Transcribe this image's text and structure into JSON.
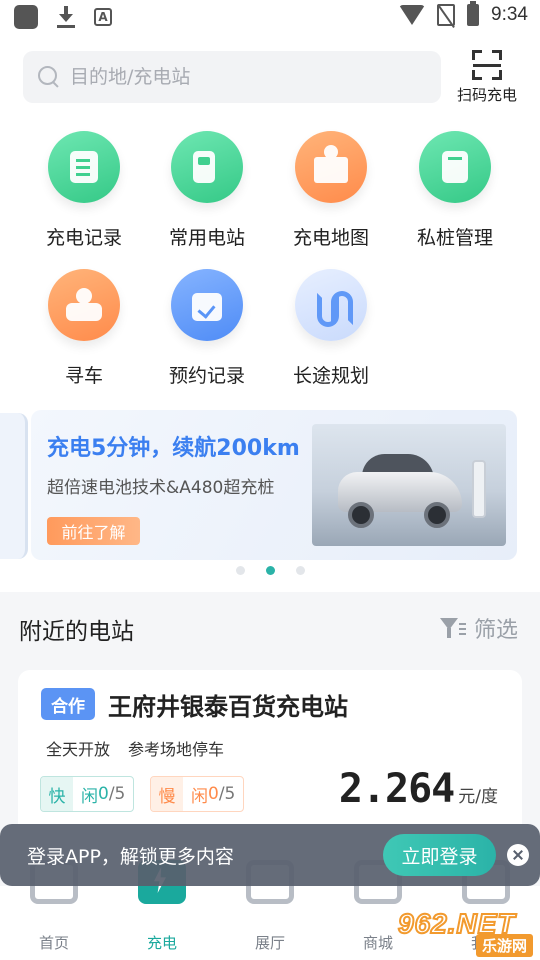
{
  "status_bar": {
    "time": "9:34"
  },
  "search": {
    "placeholder": "目的地/充电站",
    "value": ""
  },
  "scan": {
    "label": "扫码充电",
    "icon": "scan-icon"
  },
  "quick_actions": [
    {
      "label": "充电记录",
      "icon": "charge-record-icon",
      "color": "#3fd08f"
    },
    {
      "label": "常用电站",
      "icon": "favorite-station-icon",
      "color": "#3fd08f"
    },
    {
      "label": "充电地图",
      "icon": "charge-map-icon",
      "color": "#ff8b4b"
    },
    {
      "label": "私桩管理",
      "icon": "private-pile-icon",
      "color": "#3fd08f"
    },
    {
      "label": "寻车",
      "icon": "find-car-icon",
      "color": "#ff8b4b"
    },
    {
      "label": "预约记录",
      "icon": "reservation-icon",
      "color": "#5a95f7"
    },
    {
      "label": "长途规划",
      "icon": "route-planning-icon",
      "color": "#5a95f7"
    }
  ],
  "banner": {
    "headline": "充电5分钟，续航200km",
    "subline": "超倍速电池技术&A480超充桩",
    "button": "前往了解",
    "page_count": 3,
    "active_page": 2
  },
  "nearby": {
    "title": "附近的电站",
    "filter_label": "筛选",
    "stations": [
      {
        "tag": "合作",
        "name": "王府井银泰百货充电站",
        "tags": [
          "全天开放",
          "参考场地停车"
        ],
        "fast": {
          "label": "快",
          "idle_label": "闲",
          "idle": "0",
          "total": "/5"
        },
        "slow": {
          "label": "慢",
          "idle_label": "闲",
          "idle": "0",
          "total": "/5"
        },
        "price": "2.264",
        "price_unit": "元/度"
      }
    ]
  },
  "login_prompt": {
    "text": "登录APP，解锁更多内容",
    "button": "立即登录"
  },
  "tabs": [
    {
      "label": "首页",
      "active": false
    },
    {
      "label": "充电",
      "active": true
    },
    {
      "label": "展厅",
      "active": false
    },
    {
      "label": "商城",
      "active": false
    },
    {
      "label": "我的",
      "active": false
    }
  ],
  "watermark": {
    "logo": "962.NET",
    "sub": "乐游网"
  },
  "colors": {
    "accent": "#1aa99d",
    "brand_blue": "#3b7ff0",
    "orange": "#ff8b4b",
    "green": "#3fd08f"
  }
}
